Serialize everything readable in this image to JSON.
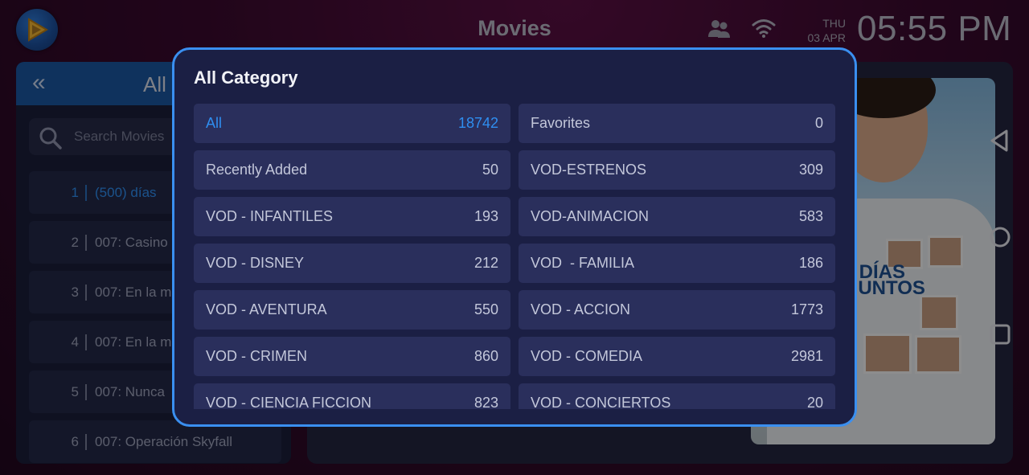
{
  "header": {
    "title": "Movies",
    "day": "THU",
    "date": "03 APR",
    "time": "05:55 PM",
    "icons": [
      "app-logo-icon",
      "multi-user-icon",
      "wifi-icon"
    ]
  },
  "left_panel": {
    "title": "All",
    "search_placeholder": "Search Movies",
    "movies": [
      {
        "num": "1",
        "title": "(500) días",
        "active": true
      },
      {
        "num": "2",
        "title": "007: Casino"
      },
      {
        "num": "3",
        "title": "007: En la m"
      },
      {
        "num": "4",
        "title": "007: En la m"
      },
      {
        "num": "5",
        "title": "007: Nunca"
      },
      {
        "num": "6",
        "title": "007: Operación Skyfall"
      }
    ]
  },
  "poster": {
    "text_line1": ") DÍAS",
    "text_line2": "JUNTOS"
  },
  "modal": {
    "title": "All Category",
    "categories": [
      {
        "name": "All",
        "count": "18742",
        "selected": true
      },
      {
        "name": "Favorites",
        "count": "0"
      },
      {
        "name": "Recently Added",
        "count": "50"
      },
      {
        "name": "VOD-ESTRENOS",
        "count": "309"
      },
      {
        "name": "VOD - INFANTILES",
        "count": "193"
      },
      {
        "name": "VOD-ANIMACION",
        "count": "583"
      },
      {
        "name": "VOD - DISNEY",
        "count": "212"
      },
      {
        "name": "VOD  - FAMILIA",
        "count": "186"
      },
      {
        "name": "VOD - AVENTURA",
        "count": "550"
      },
      {
        "name": "VOD - ACCION",
        "count": "1773"
      },
      {
        "name": "VOD - CRIMEN",
        "count": "860"
      },
      {
        "name": "VOD - COMEDIA",
        "count": "2981"
      },
      {
        "name": "VOD - CIENCIA FICCION",
        "count": "823"
      },
      {
        "name": "VOD - CONCIERTOS",
        "count": "20"
      }
    ]
  },
  "colors": {
    "accent": "#2f8ef0",
    "modal_border": "#3a8ff0",
    "modal_bg": "#1b1f44",
    "item_bg": "#2a2f5c",
    "left_header": "#1a57a0"
  },
  "system_nav": [
    "back-icon",
    "home-icon",
    "recents-icon"
  ]
}
